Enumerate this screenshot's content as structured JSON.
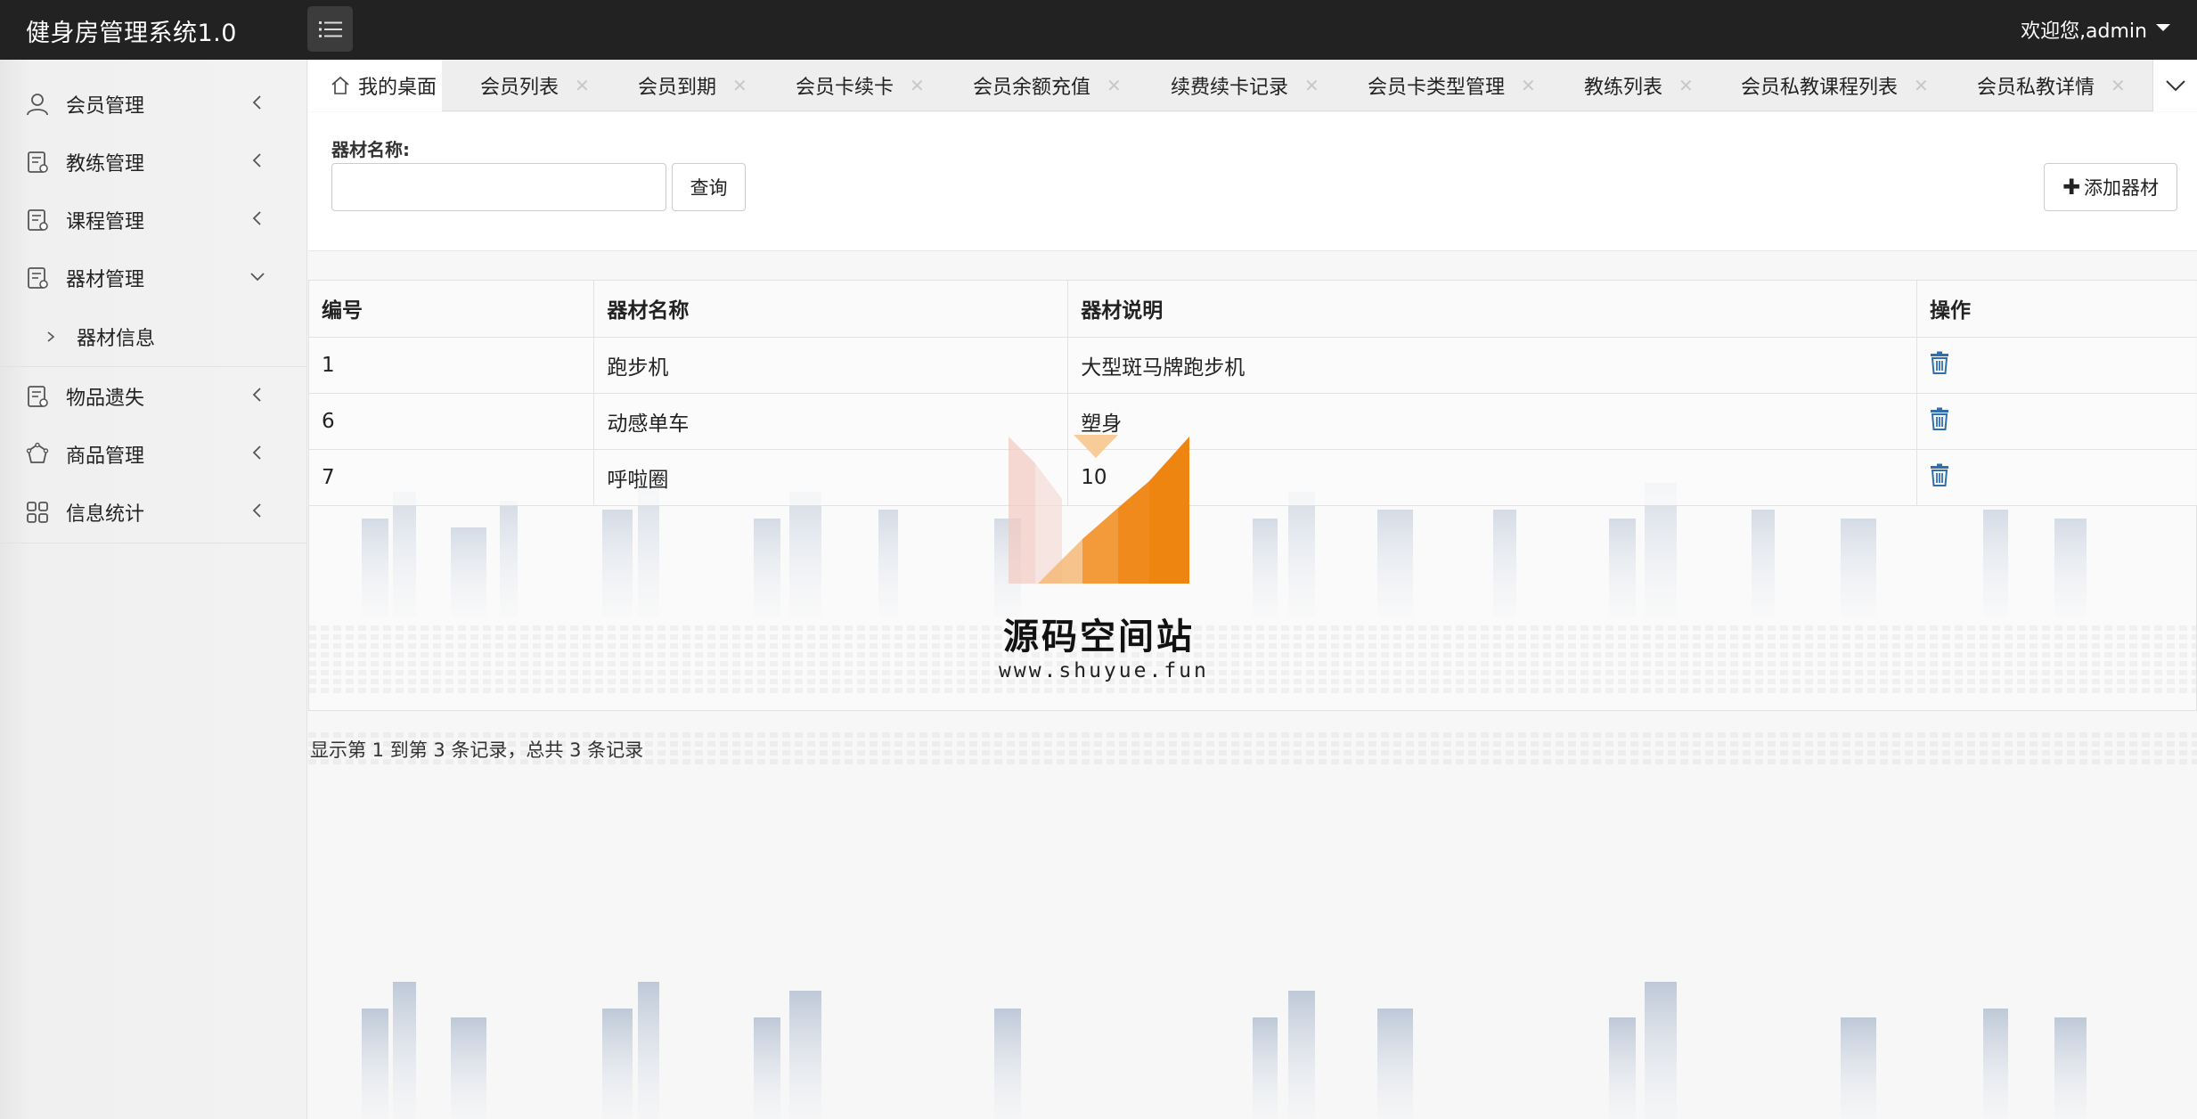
{
  "app": {
    "title": "健身房管理系统1.0",
    "user_greeting": "欢迎您,admin"
  },
  "sidebar": {
    "items": [
      {
        "label": "会员管理",
        "icon": "user-icon"
      },
      {
        "label": "教练管理",
        "icon": "document-icon"
      },
      {
        "label": "课程管理",
        "icon": "document-icon"
      },
      {
        "label": "器材管理",
        "icon": "document-icon",
        "expanded": true
      },
      {
        "label": "物品遗失",
        "icon": "document-icon"
      },
      {
        "label": "商品管理",
        "icon": "cycle-icon"
      },
      {
        "label": "信息统计",
        "icon": "grid-icon"
      }
    ],
    "sub_item": "器材信息"
  },
  "tabs": [
    {
      "label": "我的桌面"
    },
    {
      "label": "会员列表"
    },
    {
      "label": "会员到期"
    },
    {
      "label": "会员卡续卡"
    },
    {
      "label": "会员余额充值"
    },
    {
      "label": "续费续卡记录"
    },
    {
      "label": "会员卡类型管理"
    },
    {
      "label": "教练列表"
    },
    {
      "label": "会员私教课程列表"
    },
    {
      "label": "会员私教详情"
    }
  ],
  "search": {
    "label": "器材名称:",
    "value": "",
    "query_button": "查询",
    "add_button": "添加器材"
  },
  "table": {
    "headers": [
      "编号",
      "器材名称",
      "器材说明",
      "操作"
    ],
    "rows": [
      [
        "1",
        "跑步机",
        "大型斑马牌跑步机"
      ],
      [
        "6",
        "动感单车",
        "塑身"
      ],
      [
        "7",
        "呼啦圈",
        "10"
      ]
    ]
  },
  "summary": "显示第 1 到第 3 条记录，总共 3 条记录",
  "watermark": {
    "title": "源码空间站",
    "url": "www.shuyue.fun"
  },
  "colors": {
    "topbar": "#222222",
    "accent_orange": "#f08a1c",
    "trash_blue": "#2f6fb0"
  }
}
